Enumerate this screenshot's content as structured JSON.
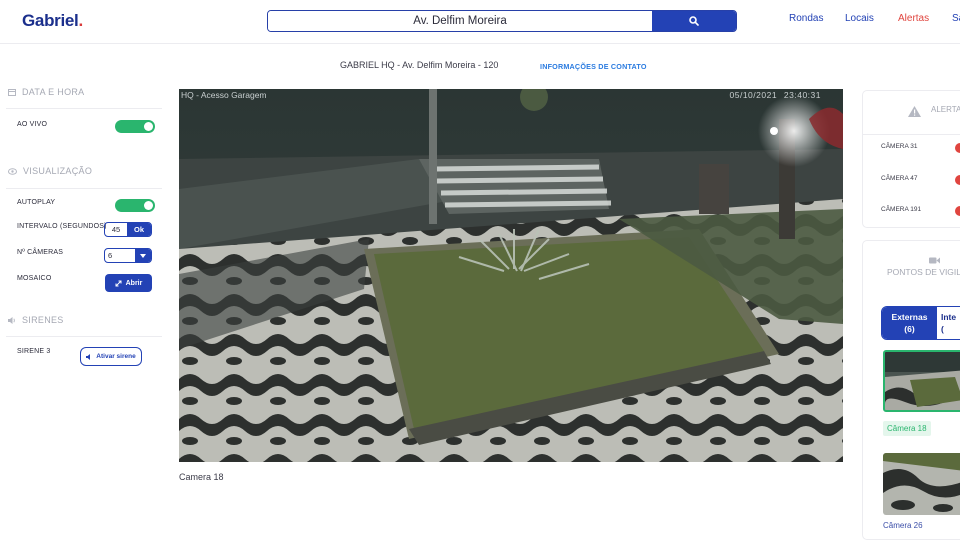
{
  "app": {
    "logo": "Gabriel",
    "logo_dot": "."
  },
  "search": {
    "value": "Av. Delfim Moreira",
    "placeholder": ""
  },
  "nav": {
    "rondas": "Rondas",
    "locais": "Locais",
    "alertas": "Alertas",
    "more": "Sa"
  },
  "site": {
    "name": "GABRIEL HQ - Av. Delfim Moreira - 120",
    "contact_link": "INFORMAÇÕES DE CONTATO"
  },
  "sidebar": {
    "datetime": {
      "title": "DATA E HORA",
      "live_label": "AO VIVO",
      "live_on": true
    },
    "view": {
      "title": "VISUALIZAÇÃO",
      "autoplay_label": "AUTOPLAY",
      "autoplay_on": true,
      "interval_label": "INTERVALO (SEGUNDOS)",
      "interval_value": "45",
      "interval_ok": "Ok",
      "cameras_label": "Nº CÂMERAS",
      "cameras_value": "6",
      "mosaic_label": "MOSAICO",
      "mosaic_button": "Abrir"
    },
    "sirens": {
      "title": "SIRENES",
      "siren_name": "SIRENE 3",
      "siren_button": "Ativar sirene"
    }
  },
  "video": {
    "overlay_name": "HQ - Acesso Garagem",
    "overlay_timestamp": "05/10/2021 23:40:31",
    "caption": "Camera 18"
  },
  "alerts": {
    "title": "ALERTA",
    "items": [
      {
        "label": "CÂMERA 31",
        "status_color": "#e0453f"
      },
      {
        "label": "CÂMERA 47",
        "status_color": "#e0453f"
      },
      {
        "label": "CÂMERA 191",
        "status_color": "#e0453f"
      }
    ]
  },
  "points": {
    "title": "PONTOS DE VIGIL",
    "tab_external": "Externas",
    "tab_external_count": "(6)",
    "tab_internal": "Inte",
    "tab_internal_count": "(",
    "cameras": [
      {
        "label": "Câmera 18",
        "selected": true
      },
      {
        "label": "Câmera 26",
        "selected": false
      }
    ]
  },
  "colors": {
    "primary": "#2342b5",
    "success": "#2ab56e",
    "alert": "#e0453f",
    "link": "#2a7be0"
  }
}
